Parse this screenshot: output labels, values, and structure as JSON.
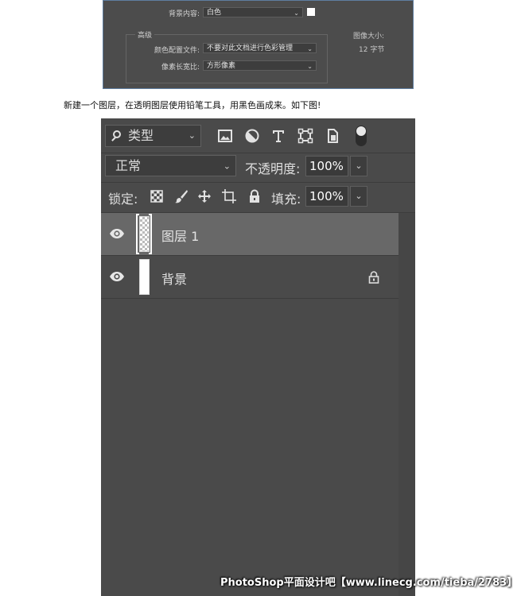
{
  "dialog": {
    "bg_content_label": "背景内容:",
    "bg_content_value": "白色",
    "advanced_label": "高级",
    "color_profile_label": "颜色配置文件:",
    "color_profile_value": "不要对此文档进行色彩管理",
    "pixel_aspect_label": "像素长宽比:",
    "pixel_aspect_value": "方形像素",
    "image_size_label": "图像大小:",
    "image_size_value": "12 字节"
  },
  "instruction": "新建一个图层，在透明图层使用铅笔工具，用黑色画成来。如下图!",
  "layers_panel": {
    "filter_kind": "类型",
    "filter_icons": [
      "image-filter-icon",
      "adjustment-filter-icon",
      "type-filter-icon",
      "shape-filter-icon",
      "smart-object-filter-icon"
    ],
    "blend_mode": "正常",
    "opacity_label": "不透明度:",
    "opacity_value": "100%",
    "lock_label": "锁定:",
    "lock_icons": [
      "lock-transparent-pixels-icon",
      "lock-image-pixels-icon",
      "lock-position-icon",
      "lock-artboard-icon",
      "lock-all-icon"
    ],
    "fill_label": "填充:",
    "fill_value": "100%",
    "layers": [
      {
        "name": "图层 1",
        "selected": true,
        "thumbnail": "transparent",
        "locked": false
      },
      {
        "name": "背景",
        "selected": false,
        "thumbnail": "white",
        "locked": true
      }
    ]
  },
  "watermark": "PhotoShop平面设计吧【www.linecg.com/tieba/2783】",
  "colors": {
    "panel_bg": "#4a4a4a",
    "selected_row": "#686868",
    "dialog_bg": "#4c4c4c"
  }
}
